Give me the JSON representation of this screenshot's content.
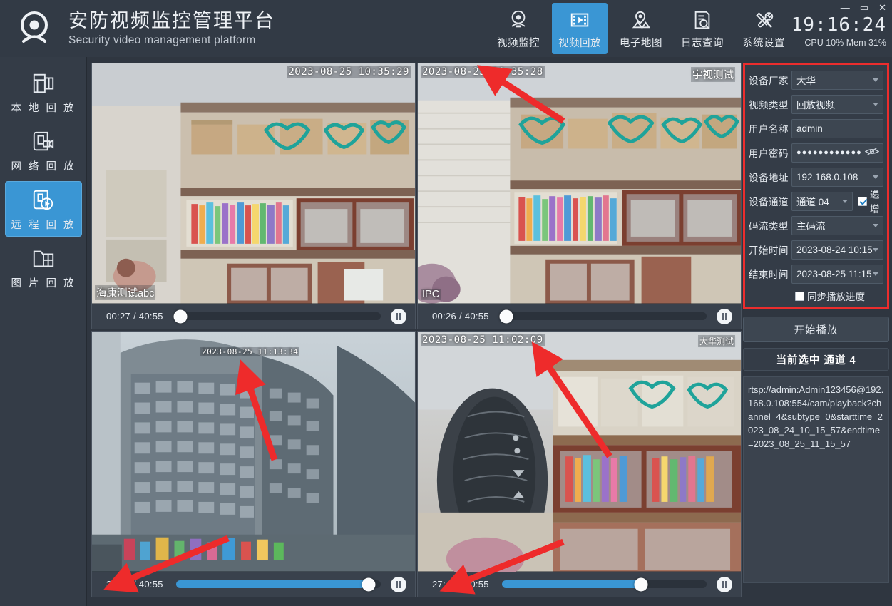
{
  "header": {
    "logo_icon": "camera-icon",
    "title": "安防视频监控管理平台",
    "subtitle": "Security video management platform",
    "nav": [
      {
        "label": "视频监控",
        "icon": "camera-monitor-icon",
        "active": false
      },
      {
        "label": "视频回放",
        "icon": "film-play-icon",
        "active": true
      },
      {
        "label": "电子地图",
        "icon": "map-pin-icon",
        "active": false
      },
      {
        "label": "日志查询",
        "icon": "document-search-icon",
        "active": false
      },
      {
        "label": "系统设置",
        "icon": "tools-icon",
        "active": false
      }
    ],
    "window_controls": {
      "minimize": "—",
      "maximize": "▭",
      "close": "✕"
    },
    "clock": "19:16:24",
    "cpu": "CPU 10%",
    "mem": "Mem 31%"
  },
  "sidebar": {
    "items": [
      {
        "label": "本 地 回 放",
        "icon": "local-playback-icon",
        "active": false
      },
      {
        "label": "网 络 回 放",
        "icon": "network-playback-icon",
        "active": false
      },
      {
        "label": "远 程 回 放",
        "icon": "remote-playback-icon",
        "active": true
      },
      {
        "label": "图 片 回 放",
        "icon": "picture-playback-icon",
        "active": false
      }
    ]
  },
  "grid": {
    "cells": [
      {
        "timestamp": "2023-08-25 10:35:29",
        "timestamp_pos": "right",
        "label_bl": "海康测试abc",
        "label_tr": "",
        "current_time": "00:27",
        "total_time": "40:55",
        "progress_pct": 2,
        "pause_icon": "pause-icon"
      },
      {
        "timestamp": "2023-08-25 10:35:28",
        "timestamp_pos": "left",
        "label_bl": "IPC",
        "label_tr": "宇视测试",
        "current_time": "00:26",
        "total_time": "40:55",
        "progress_pct": 2,
        "pause_icon": "pause-icon"
      },
      {
        "timestamp": "2023-08-25 11:13:34",
        "timestamp_pos": "mid",
        "label_bl": "",
        "label_tr": "",
        "current_time": "38:32",
        "total_time": "40:55",
        "progress_pct": 94,
        "pause_icon": "pause-icon"
      },
      {
        "timestamp": "2023-08-25 11:02:09",
        "timestamp_pos": "left",
        "label_bl": "",
        "label_tr": "大华测试",
        "current_time": "27:45",
        "total_time": "40:55",
        "progress_pct": 68,
        "pause_icon": "pause-icon"
      }
    ]
  },
  "config": {
    "vendor": {
      "label": "设备厂家",
      "value": "大华"
    },
    "video_type": {
      "label": "视频类型",
      "value": "回放视频"
    },
    "username": {
      "label": "用户名称",
      "value": "admin"
    },
    "password": {
      "label": "用户密码",
      "value": "●●●●●●●●●●●●",
      "eye_icon": "eye-off-icon"
    },
    "address": {
      "label": "设备地址",
      "value": "192.168.0.108"
    },
    "channel": {
      "label": "设备通道",
      "value": "通道 04",
      "increment_label": "递增",
      "increment_checked": true
    },
    "stream_type": {
      "label": "码流类型",
      "value": "主码流"
    },
    "start_time": {
      "label": "开始时间",
      "value": "2023-08-24 10:15"
    },
    "end_time": {
      "label": "结束时间",
      "value": "2023-08-25 11:15"
    },
    "sync_progress": {
      "label": "同步播放进度",
      "checked": false
    },
    "start_button": "开始播放",
    "current_channel": "当前选中 通道 4",
    "rtsp_url": "rtsp://admin:Admin123456@192.168.0.108:554/cam/playback?channel=4&subtype=0&starttime=2023_08_24_10_15_57&endtime=2023_08_25_11_15_57"
  },
  "colors": {
    "accent": "#3a96d4",
    "header_bg": "#323a45",
    "panel_bg": "#343c47",
    "highlight_border": "#ec2d2d",
    "arrow": "#ee2b2b"
  }
}
